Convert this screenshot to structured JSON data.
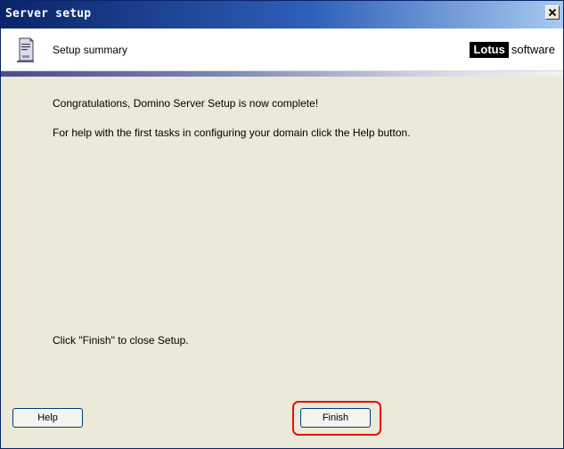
{
  "window": {
    "title": "Server setup"
  },
  "header": {
    "title": "Setup summary",
    "logo_word1": "Lotus",
    "logo_word2": "software"
  },
  "content": {
    "line1": "Congratulations, Domino Server Setup is now complete!",
    "line2": "For help with the first tasks in configuring your domain click the Help button.",
    "line3": "Click \"Finish\" to close Setup."
  },
  "buttons": {
    "help_label": "Help",
    "finish_label": "Finish"
  },
  "icons": {
    "close": "close-icon",
    "server": "server-icon"
  },
  "colors": {
    "title_bar": "#0a246a",
    "highlight": "#e11010",
    "window_bg": "#ece9d8"
  }
}
